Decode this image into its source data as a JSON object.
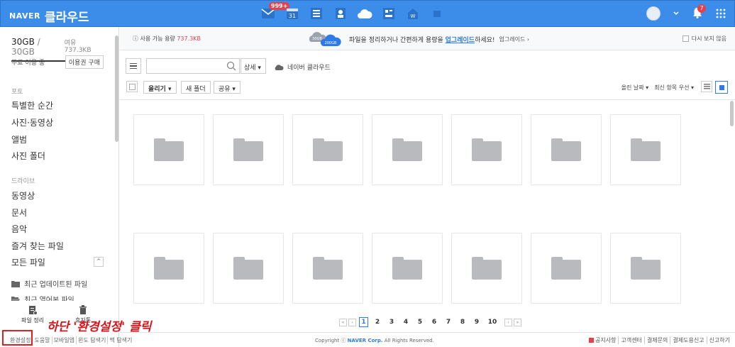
{
  "header": {
    "brand": "NAVER",
    "product": "클라우드",
    "mail_badge": "999+",
    "calendar_day": "31",
    "notif_badge": "7",
    "accent": "#3b8de9"
  },
  "sidebar": {
    "quota_used": "30GB",
    "quota_sep": " / ",
    "quota_total": "30GB",
    "quota_remain": "여유 737.3KB",
    "free_label": "무료 이용 중",
    "buy_button": "이용권 구매",
    "photo_section": "포토",
    "photo_items": [
      "특별한 순간",
      "사진·동영상",
      "앨범",
      "사진 폴더"
    ],
    "drive_section": "드라이브",
    "drive_items": [
      "동영상",
      "문서",
      "음악",
      "즐겨 찾는 파일",
      "모든 파일"
    ],
    "sub_items": [
      "최근 업데이트된 파일",
      "최근 열어본 파일"
    ],
    "tool_organize": "파일 정리",
    "tool_trash": "휴지통"
  },
  "footer_links": [
    "환경설정",
    "도움말",
    "모바일앱",
    "윈도 탐색기",
    "맥 탐색기"
  ],
  "annotation": "하단 '환경설정' 클릭",
  "notice": {
    "usable_label": "사용 가능 용량",
    "usable_value": "737.3KB",
    "cloud_small": "30GB",
    "cloud_big": "200GB",
    "promo_prefix": "파일을 정리하거나 간편하게 용량을 ",
    "promo_link": "업그레이드",
    "promo_suffix": "하세요!",
    "upgrade_link": "업그레이드 ›",
    "hide_label": "다시 보지 않음"
  },
  "toolbar": {
    "search_placeholder": "",
    "detail_label": "상세 ▾",
    "naver_cloud": "네이버 클라우드",
    "upload": "올리기 ▾",
    "new_folder": "새 폴더",
    "share": "공유 ▾",
    "sort_by": "올린 날짜 ▾",
    "sort_order": "최신 항목 우선 ▾"
  },
  "pagination": {
    "pages": [
      "1",
      "2",
      "3",
      "4",
      "5",
      "6",
      "7",
      "8",
      "9",
      "10"
    ],
    "current": "1",
    "first": "«",
    "prev": "‹",
    "next": "›",
    "last": "»"
  },
  "footer": {
    "copyright_prefix": "Copyright ⓒ ",
    "copyright_corp": "NAVER Corp.",
    "copyright_suffix": " All Rights Reserved.",
    "links": [
      "공지사항",
      "고객센터",
      "결제문의",
      "결제도용신고",
      "신고하기"
    ]
  }
}
